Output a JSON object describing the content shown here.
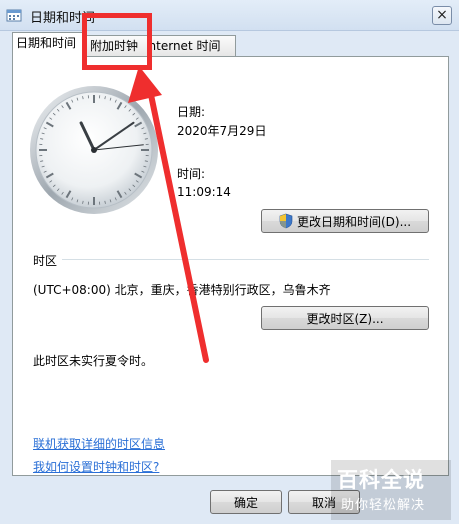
{
  "window": {
    "title": "日期和时间",
    "close_glyph": "×"
  },
  "tabs": [
    {
      "label": "日期和时间",
      "active": true
    },
    {
      "label": "附加时钟",
      "active": false
    },
    {
      "label": "Internet 时间",
      "active": false
    }
  ],
  "clock": {
    "hour": 11,
    "minute": 9,
    "second": 14
  },
  "date": {
    "label": "日期:",
    "value": "2020年7月29日"
  },
  "time": {
    "label": "时间:",
    "value": "11:09:14"
  },
  "change_datetime_button": {
    "label": "更改日期和时间(D)...",
    "icon": "uac-shield-icon"
  },
  "timezone": {
    "section_label": "时区",
    "value": "(UTC+08:00) 北京，重庆，香港特别行政区，乌鲁木齐",
    "change_button": "更改时区(Z)...",
    "dst_note": "此时区未实行夏令时。"
  },
  "links": {
    "online_info": "联机获取详细的时区信息",
    "how_to_set": "我如何设置时钟和时区?"
  },
  "footer": {
    "ok": "确定",
    "cancel": "取消"
  },
  "watermark": {
    "title": "百科全说",
    "subtitle": "助你轻松解决"
  },
  "colors": {
    "highlight": "#ef2e2e",
    "link": "#2a6fd6"
  }
}
